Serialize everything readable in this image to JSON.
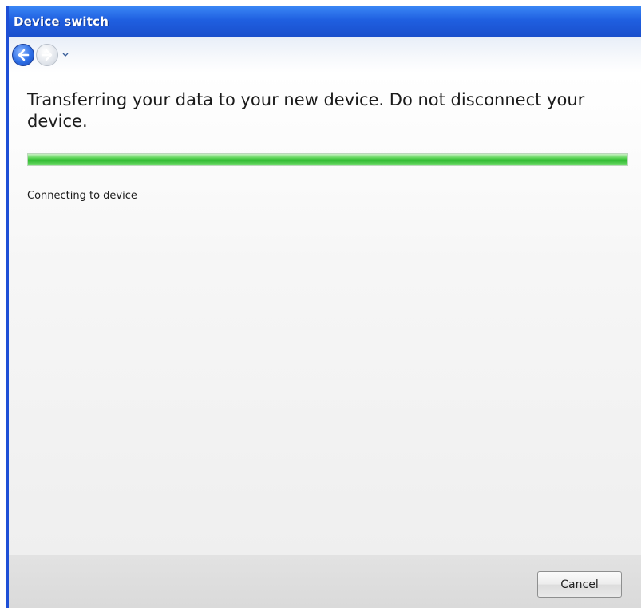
{
  "window": {
    "title": "Device switch"
  },
  "navigation": {
    "back_icon": "back-arrow-icon",
    "forward_icon": "forward-arrow-icon",
    "dropdown_icon": "chevron-down-icon"
  },
  "main": {
    "headline": "Transferring your data to your new device. Do not disconnect your device.",
    "progress": {
      "value_percent": 100
    },
    "status": "Connecting to device"
  },
  "footer": {
    "cancel_label": "Cancel"
  },
  "colors": {
    "titlebar": "#1f5fe0",
    "progress_fill": "#2fb92f",
    "content_bg": "#f3f3f3"
  }
}
